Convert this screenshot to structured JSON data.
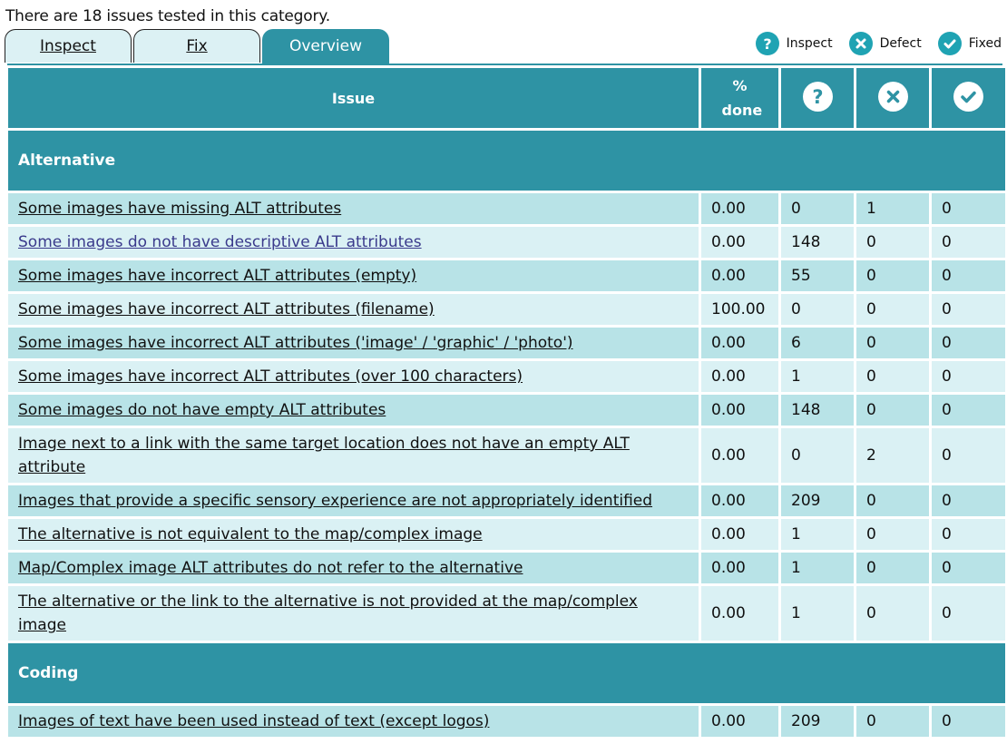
{
  "summary": "There are 18 issues tested in this category.",
  "tabs": [
    {
      "label": "Inspect",
      "active": false
    },
    {
      "label": "Fix",
      "active": false
    },
    {
      "label": "Overview",
      "active": true
    }
  ],
  "legend": {
    "inspect": {
      "icon": "question-circle-icon",
      "label": "Inspect"
    },
    "defect": {
      "icon": "x-circle-icon",
      "label": "Defect"
    },
    "fixed": {
      "icon": "check-circle-icon",
      "label": "Fixed"
    }
  },
  "colors": {
    "accent": "#2e93a4",
    "legend_icon": "#1fa3b3",
    "row_odd": "#b8e3e7",
    "row_even": "#daf1f4",
    "visited_link": "#3a3a8c"
  },
  "table": {
    "headers": {
      "issue": "Issue",
      "done": "% done",
      "inspect_icon": "question-circle-icon",
      "defect_icon": "x-circle-icon",
      "fixed_icon": "check-circle-icon"
    },
    "sections": [
      {
        "title": "Alternative",
        "rows": [
          {
            "issue": "Some images have missing ALT attributes",
            "done": "0.00",
            "inspect": "0",
            "defect": "1",
            "fixed": "0"
          },
          {
            "issue": "Some images do not have descriptive ALT attributes",
            "done": "0.00",
            "inspect": "148",
            "defect": "0",
            "fixed": "0",
            "visited": true
          },
          {
            "issue": "Some images have incorrect ALT attributes (empty)",
            "done": "0.00",
            "inspect": "55",
            "defect": "0",
            "fixed": "0"
          },
          {
            "issue": "Some images have incorrect ALT attributes (filename)",
            "done": "100.00",
            "inspect": "0",
            "defect": "0",
            "fixed": "0"
          },
          {
            "issue": "Some images have incorrect ALT attributes ('image' / 'graphic' / 'photo')",
            "done": "0.00",
            "inspect": "6",
            "defect": "0",
            "fixed": "0"
          },
          {
            "issue": "Some images have incorrect ALT attributes (over 100 characters)",
            "done": "0.00",
            "inspect": "1",
            "defect": "0",
            "fixed": "0"
          },
          {
            "issue": "Some images do not have empty ALT attributes",
            "done": "0.00",
            "inspect": "148",
            "defect": "0",
            "fixed": "0"
          },
          {
            "issue": "Image next to a link with the same target location does not have an empty ALT attribute",
            "done": "0.00",
            "inspect": "0",
            "defect": "2",
            "fixed": "0",
            "wrap": true
          },
          {
            "issue": "Images that provide a specific sensory experience are not appropriately identified",
            "done": "0.00",
            "inspect": "209",
            "defect": "0",
            "fixed": "0"
          },
          {
            "issue": "The alternative is not equivalent to the map/complex image",
            "done": "0.00",
            "inspect": "1",
            "defect": "0",
            "fixed": "0"
          },
          {
            "issue": "Map/Complex image ALT attributes do not refer to the alternative",
            "done": "0.00",
            "inspect": "1",
            "defect": "0",
            "fixed": "0"
          },
          {
            "issue": "The alternative or the link to the alternative is not provided at the map/complex image",
            "done": "0.00",
            "inspect": "1",
            "defect": "0",
            "fixed": "0",
            "wrap": true
          }
        ]
      },
      {
        "title": "Coding",
        "rows": [
          {
            "issue": "Images of text have been used instead of text (except logos)",
            "done": "0.00",
            "inspect": "209",
            "defect": "0",
            "fixed": "0"
          }
        ]
      }
    ]
  }
}
